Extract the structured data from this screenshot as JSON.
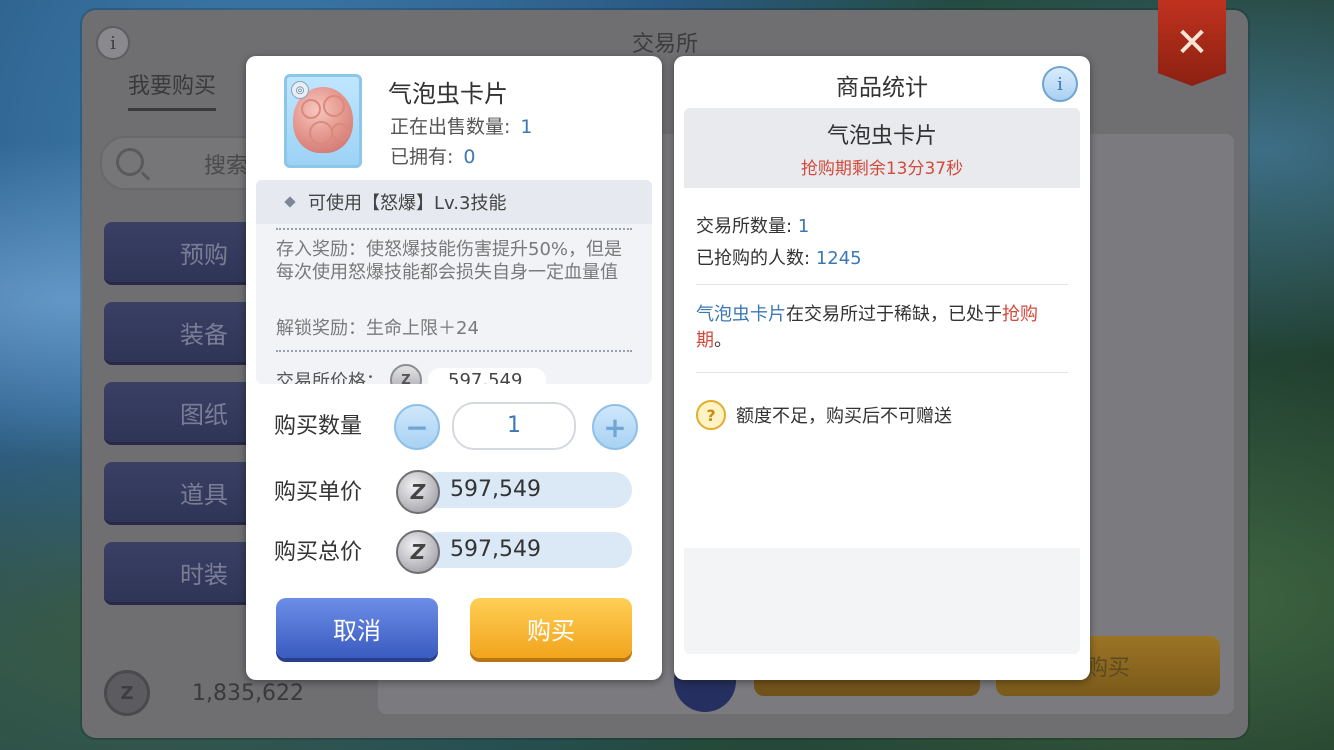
{
  "main": {
    "title": "交易所",
    "tab_buy": "我要购买",
    "search_placeholder": "搜索",
    "categories": [
      "预购",
      "装备",
      "图纸",
      "道具",
      "时装"
    ],
    "currency_amount": "1,835,622",
    "buy_button": "购买",
    "close_icon": "close-icon",
    "info_icon": "info-icon"
  },
  "buy_dialog": {
    "item_name": "气泡虫卡片",
    "on_sale_label": "正在出售数量:",
    "on_sale_value": "1",
    "owned_label": "已拥有:",
    "owned_value": "0",
    "skill_line": "可使用【怒爆】Lv.3技能",
    "deposit_reward": "存入奖励：使怒爆技能伤害提升50%，但是每次使用怒爆技能都会损失自身一定血量值",
    "unlock_reward": "解锁奖励：生命上限＋24",
    "exchange_price_label": "交易所价格：",
    "exchange_price_value": "597,549",
    "qty_label": "购买数量",
    "qty_value": "1",
    "unit_price_label": "购买单价",
    "unit_price_value": "597,549",
    "total_price_label": "购买总价",
    "total_price_value": "597,549",
    "coin_glyph": "Z",
    "cancel_label": "取消",
    "buy_label": "购买"
  },
  "stats_dialog": {
    "title": "商品统计",
    "item_name": "气泡虫卡片",
    "timer": "抢购期剩余13分37秒",
    "exchange_count_label": "交易所数量:",
    "exchange_count_value": "1",
    "snapped_label": "已抢购的人数:",
    "snapped_value": "1245",
    "notice_item": "气泡虫卡片",
    "notice_mid": "在交易所过于稀缺，已处于",
    "notice_red": "抢购期",
    "notice_end": "。",
    "warning": "额度不足，购买后不可赠送"
  },
  "colors": {
    "accent_blue": "#3c78b4",
    "alert_red": "#d24a3c",
    "buy_orange": "#f2a41d",
    "cancel_blue": "#3a5bc0"
  }
}
